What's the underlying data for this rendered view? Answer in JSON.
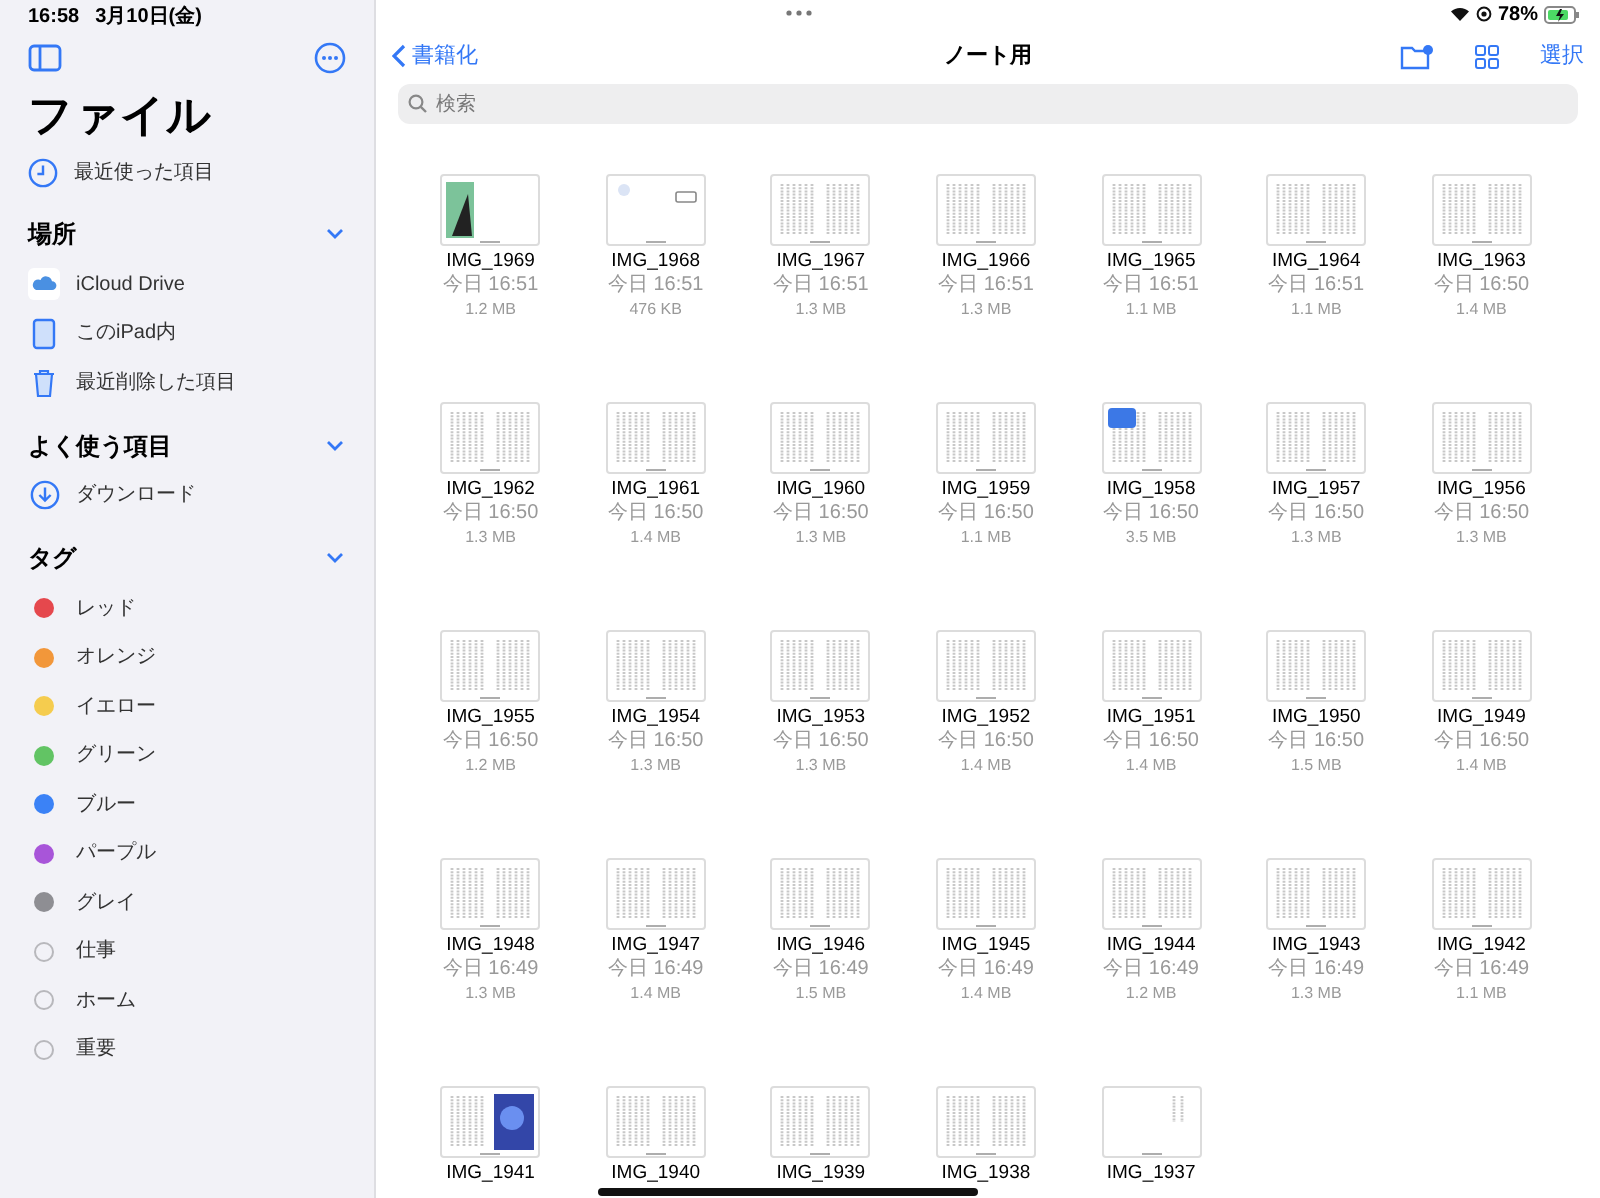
{
  "status_bar": {
    "time": "16:58",
    "date": "3月10日(金)",
    "battery": "78%"
  },
  "sidebar": {
    "title": "ファイル",
    "recents": "最近使った項目",
    "sections": [
      {
        "title": "場所",
        "expanded": true,
        "items": [
          {
            "kind": "cloud",
            "label": "iCloud Drive"
          },
          {
            "kind": "ipad",
            "label": "このiPad内"
          },
          {
            "kind": "trash",
            "label": "最近削除した項目"
          }
        ]
      },
      {
        "title": "よく使う項目",
        "expanded": true,
        "items": [
          {
            "kind": "download",
            "label": "ダウンロード"
          }
        ]
      },
      {
        "title": "タグ",
        "expanded": true,
        "items": [
          {
            "kind": "tag",
            "label": "レッド",
            "color": "#e5484d"
          },
          {
            "kind": "tag",
            "label": "オレンジ",
            "color": "#f2973a"
          },
          {
            "kind": "tag",
            "label": "イエロー",
            "color": "#f5cc4e"
          },
          {
            "kind": "tag",
            "label": "グリーン",
            "color": "#62c464"
          },
          {
            "kind": "tag",
            "label": "ブルー",
            "color": "#3b82f6"
          },
          {
            "kind": "tag",
            "label": "パープル",
            "color": "#a855d9"
          },
          {
            "kind": "tag",
            "label": "グレイ",
            "color": "#8e8e93"
          },
          {
            "kind": "empty-tag",
            "label": "仕事"
          },
          {
            "kind": "empty-tag",
            "label": "ホーム"
          },
          {
            "kind": "empty-tag",
            "label": "重要"
          }
        ]
      }
    ]
  },
  "nav": {
    "back": "書籍化",
    "title": "ノート用",
    "select": "選択"
  },
  "search": {
    "placeholder": "検索"
  },
  "files": [
    {
      "name": "IMG_1969",
      "date": "今日 16:51",
      "size": "1.2 MB",
      "kind": "cover"
    },
    {
      "name": "IMG_1968",
      "date": "今日 16:51",
      "size": "476 KB",
      "kind": "sparse"
    },
    {
      "name": "IMG_1967",
      "date": "今日 16:51",
      "size": "1.3 MB",
      "kind": "text"
    },
    {
      "name": "IMG_1966",
      "date": "今日 16:51",
      "size": "1.3 MB",
      "kind": "text"
    },
    {
      "name": "IMG_1965",
      "date": "今日 16:51",
      "size": "1.1 MB",
      "kind": "text"
    },
    {
      "name": "IMG_1964",
      "date": "今日 16:51",
      "size": "1.1 MB",
      "kind": "text"
    },
    {
      "name": "IMG_1963",
      "date": "今日 16:50",
      "size": "1.4 MB",
      "kind": "text"
    },
    {
      "name": "IMG_1962",
      "date": "今日 16:50",
      "size": "1.3 MB",
      "kind": "text"
    },
    {
      "name": "IMG_1961",
      "date": "今日 16:50",
      "size": "1.4 MB",
      "kind": "text"
    },
    {
      "name": "IMG_1960",
      "date": "今日 16:50",
      "size": "1.3 MB",
      "kind": "text"
    },
    {
      "name": "IMG_1959",
      "date": "今日 16:50",
      "size": "1.1 MB",
      "kind": "text"
    },
    {
      "name": "IMG_1958",
      "date": "今日 16:50",
      "size": "3.5 MB",
      "kind": "sticker"
    },
    {
      "name": "IMG_1957",
      "date": "今日 16:50",
      "size": "1.3 MB",
      "kind": "text"
    },
    {
      "name": "IMG_1956",
      "date": "今日 16:50",
      "size": "1.3 MB",
      "kind": "text"
    },
    {
      "name": "IMG_1955",
      "date": "今日 16:50",
      "size": "1.2 MB",
      "kind": "text"
    },
    {
      "name": "IMG_1954",
      "date": "今日 16:50",
      "size": "1.3 MB",
      "kind": "text"
    },
    {
      "name": "IMG_1953",
      "date": "今日 16:50",
      "size": "1.3 MB",
      "kind": "text"
    },
    {
      "name": "IMG_1952",
      "date": "今日 16:50",
      "size": "1.4 MB",
      "kind": "text"
    },
    {
      "name": "IMG_1951",
      "date": "今日 16:50",
      "size": "1.4 MB",
      "kind": "text"
    },
    {
      "name": "IMG_1950",
      "date": "今日 16:50",
      "size": "1.5 MB",
      "kind": "text"
    },
    {
      "name": "IMG_1949",
      "date": "今日 16:50",
      "size": "1.4 MB",
      "kind": "text"
    },
    {
      "name": "IMG_1948",
      "date": "今日 16:49",
      "size": "1.3 MB",
      "kind": "text"
    },
    {
      "name": "IMG_1947",
      "date": "今日 16:49",
      "size": "1.4 MB",
      "kind": "text"
    },
    {
      "name": "IMG_1946",
      "date": "今日 16:49",
      "size": "1.5 MB",
      "kind": "text"
    },
    {
      "name": "IMG_1945",
      "date": "今日 16:49",
      "size": "1.4 MB",
      "kind": "text"
    },
    {
      "name": "IMG_1944",
      "date": "今日 16:49",
      "size": "1.2 MB",
      "kind": "text"
    },
    {
      "name": "IMG_1943",
      "date": "今日 16:49",
      "size": "1.3 MB",
      "kind": "text"
    },
    {
      "name": "IMG_1942",
      "date": "今日 16:49",
      "size": "1.1 MB",
      "kind": "text"
    },
    {
      "name": "IMG_1941",
      "kind": "photo"
    },
    {
      "name": "IMG_1940",
      "kind": "text"
    },
    {
      "name": "IMG_1939",
      "kind": "text"
    },
    {
      "name": "IMG_1938",
      "kind": "text"
    },
    {
      "name": "IMG_1937",
      "kind": "blank"
    }
  ]
}
